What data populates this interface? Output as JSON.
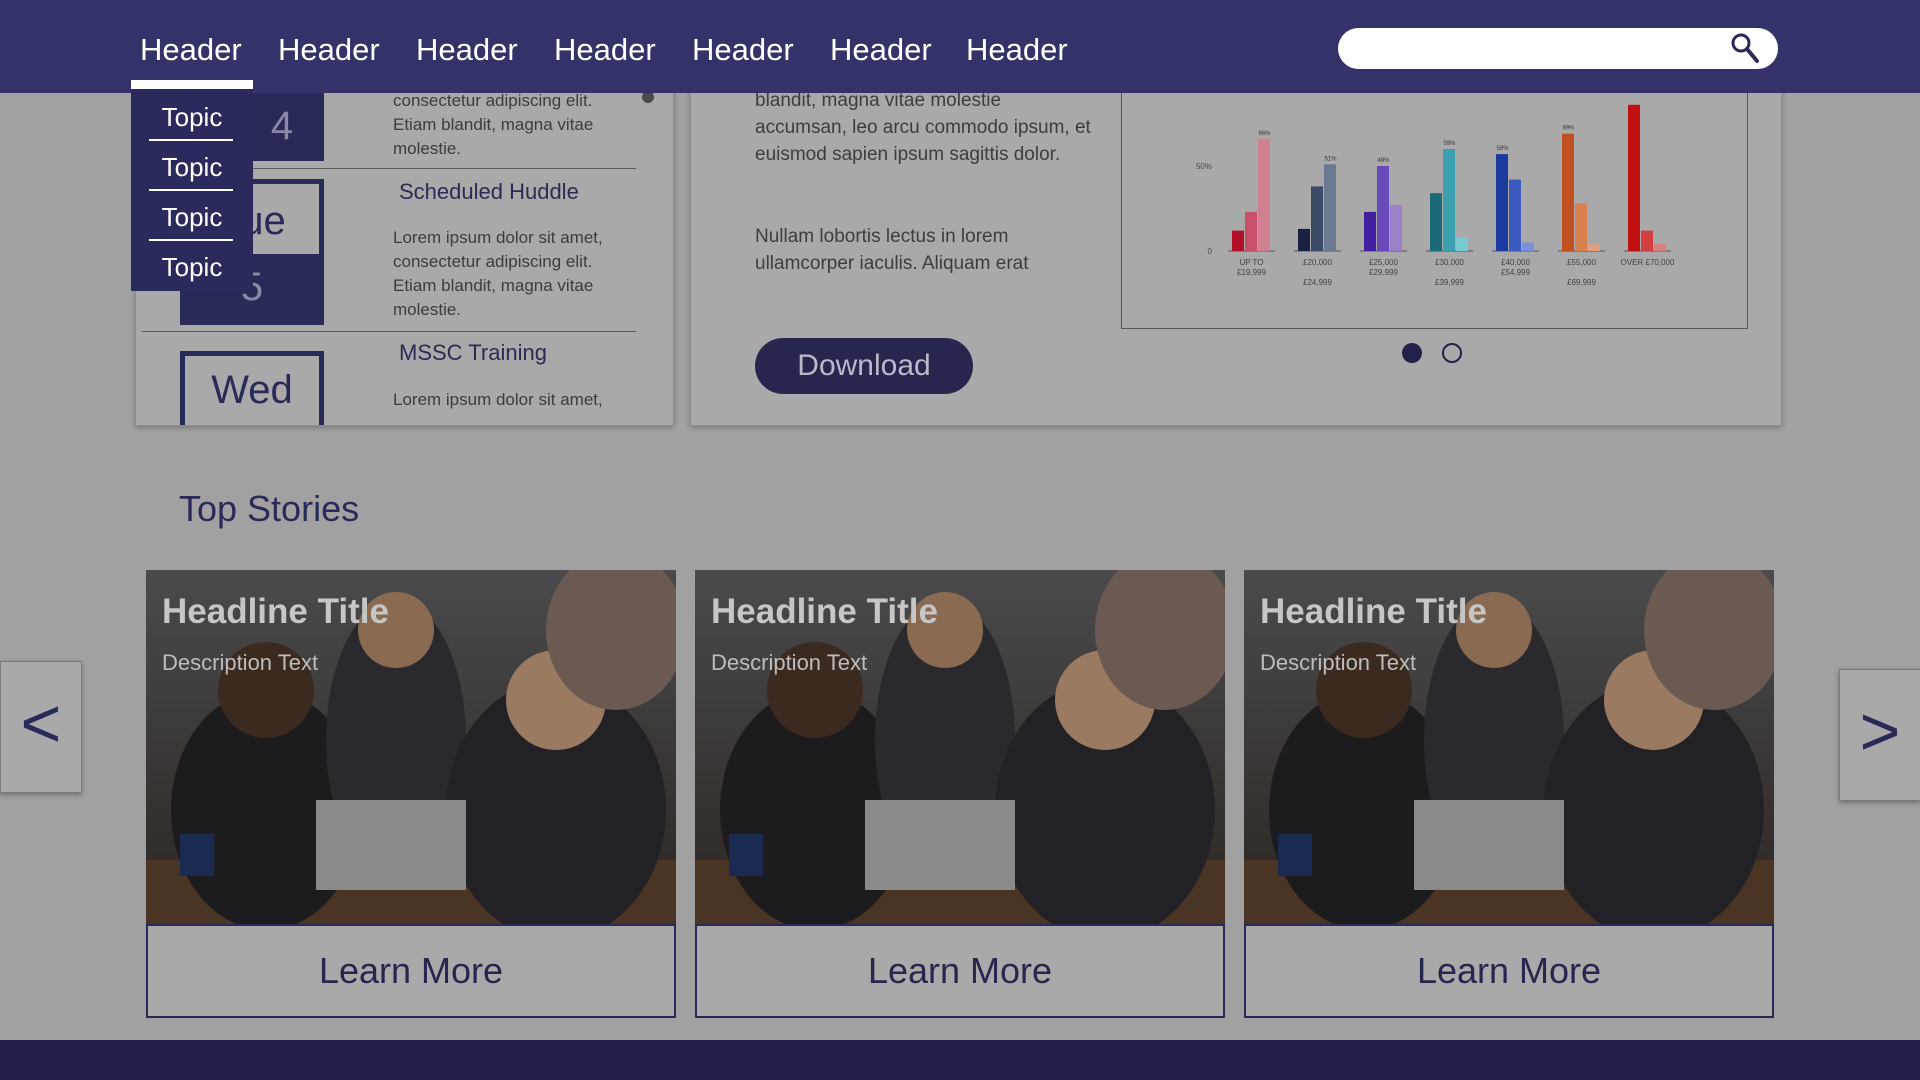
{
  "nav": {
    "items": [
      "Header",
      "Header",
      "Header",
      "Header",
      "Header",
      "Header",
      "Header"
    ],
    "active_index": 0
  },
  "search": {
    "placeholder": ""
  },
  "dropdown": {
    "items": [
      "Topic",
      "Topic",
      "Topic",
      "Topic"
    ]
  },
  "events": {
    "items": [
      {
        "date_line1": "4",
        "date_line2": "",
        "title": "",
        "body": "consectetur adipiscing elit. Etiam blandit, magna vitae molestie."
      },
      {
        "date_line1": "Tue",
        "date_line2": "5",
        "title": "Scheduled Huddle",
        "body": "Lorem ipsum dolor sit amet, consectetur adipiscing elit. Etiam blandit, magna vitae molestie."
      },
      {
        "date_line1": "Wed",
        "date_line2": "",
        "title": "MSSC Training",
        "body": "Lorem ipsum dolor sit amet,"
      }
    ]
  },
  "info": {
    "paragraph1": "blandit, magna vitae molestie accumsan, leo arcu commodo ipsum, et euismod sapien ipsum sagittis dolor.",
    "paragraph2": "Nullam lobortis lectus in lorem ullamcorper iaculis. Aliquam erat",
    "download_label": "Download"
  },
  "chart_data": {
    "type": "bar",
    "title": "",
    "xlabel": "",
    "ylabel": "",
    "y_ticks": [
      "0",
      "50%"
    ],
    "ylim": [
      0,
      100
    ],
    "categories": [
      [
        "UP TO",
        "£19,999"
      ],
      [
        "£20,000",
        "£24,999"
      ],
      [
        "£25,000",
        "£29,999"
      ],
      [
        "£30,000",
        "£39,999"
      ],
      [
        "£40,000",
        "£54,999"
      ],
      [
        "£55,000",
        "£69,999"
      ],
      [
        "OVER £70,000",
        ""
      ]
    ],
    "groups": [
      {
        "values": [
          12,
          23,
          66
        ],
        "colors": [
          "#b0102a",
          "#c8506a",
          "#d08090"
        ],
        "peak_label": "66%"
      },
      {
        "values": [
          13,
          38,
          51
        ],
        "colors": [
          "#1a2040",
          "#3c4a68",
          "#6a7890"
        ],
        "peak_label": "51%"
      },
      {
        "values": [
          23,
          50,
          27
        ],
        "colors": [
          "#4020a0",
          "#6a4ab8",
          "#9a80c8"
        ],
        "peak_label": "49%"
      },
      {
        "values": [
          34,
          60,
          8
        ],
        "colors": [
          "#1a6a7a",
          "#3aa0b0",
          "#7ac8d0"
        ],
        "peak_label": "59%"
      },
      {
        "values": [
          57,
          42,
          5
        ],
        "colors": [
          "#1a3aa0",
          "#3a5ac0",
          "#7a90d8"
        ],
        "peak_label": "58%"
      },
      {
        "values": [
          69,
          28,
          4
        ],
        "colors": [
          "#c05020",
          "#d88050",
          "#e0a080"
        ],
        "peak_label": "69%"
      },
      {
        "values": [
          86,
          12,
          4
        ],
        "colors": [
          "#c01010",
          "#d04040",
          "#d88080"
        ],
        "peak_label": ""
      }
    ],
    "carousel": {
      "active": 0,
      "count": 2
    }
  },
  "stories": {
    "title": "Top Stories",
    "cards": [
      {
        "headline": "Headline Title",
        "description": "Description Text",
        "button": "Learn More"
      },
      {
        "headline": "Headline Title",
        "description": "Description Text",
        "button": "Learn More"
      },
      {
        "headline": "Headline Title",
        "description": "Description Text",
        "button": "Learn More"
      }
    ],
    "prev_label": "<",
    "next_label": ">"
  }
}
